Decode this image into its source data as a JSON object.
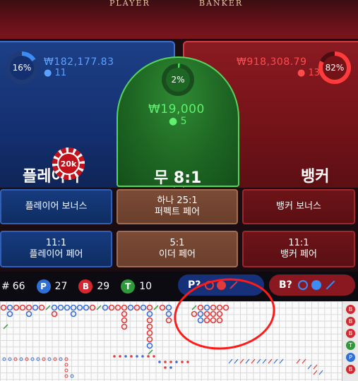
{
  "table": {
    "top_player": "PLAYER",
    "top_banker": "BANKER"
  },
  "player": {
    "percent": "16%",
    "amount": "₩182,177.83",
    "count": "11",
    "label": "플레이어",
    "color": "#3b8cf5"
  },
  "tie": {
    "percent": "2%",
    "amount": "₩19,000",
    "count": "5",
    "label": "무 8:1",
    "color": "#49e05a"
  },
  "banker": {
    "percent": "82%",
    "amount": "₩918,308.79",
    "count": "13",
    "label": "뱅커",
    "color": "#ff3b3b"
  },
  "chip": {
    "label": "20k"
  },
  "side_bets": {
    "player_bonus": "플레이어 보너스",
    "perfect_pair_line1": "하나 25:1",
    "perfect_pair_line2": "퍼펙트 페어",
    "banker_bonus": "뱅커 보너스",
    "player_pair_line1": "11:1",
    "player_pair_line2": "플레이어 페어",
    "either_pair_line1": "5:1",
    "either_pair_line2": "이더 페어",
    "banker_pair_line1": "11:1",
    "banker_pair_line2": "뱅커 페어"
  },
  "stats": {
    "total_prefix": "#",
    "total": "66",
    "p_label": "P",
    "p": "27",
    "b_label": "B",
    "b": "29",
    "t_label": "T",
    "t": "10"
  },
  "predict": {
    "player": "P?",
    "banker": "B?"
  },
  "side_strip": [
    "B",
    "B",
    "B",
    "T",
    "P",
    "B"
  ]
}
